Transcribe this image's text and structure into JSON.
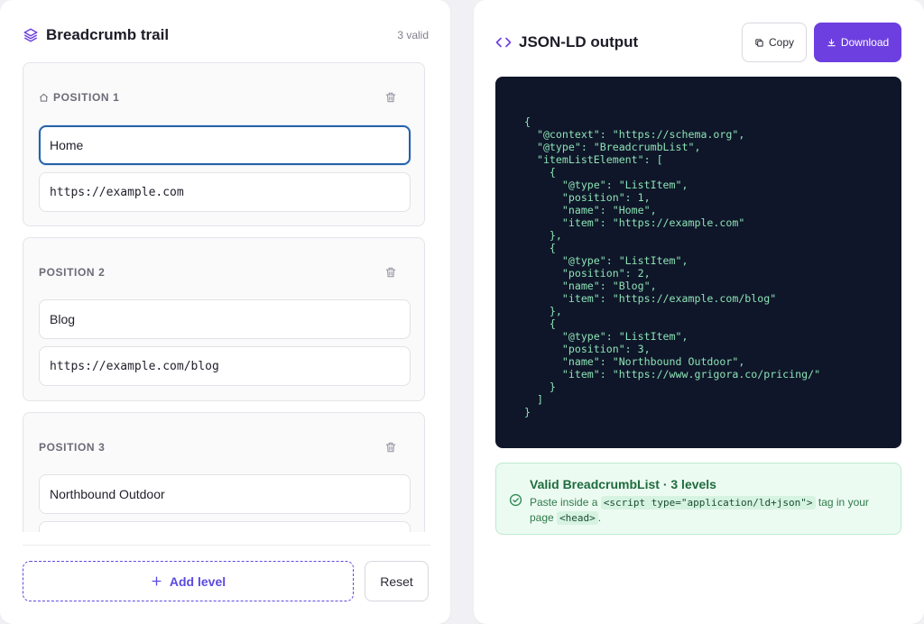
{
  "left": {
    "title": "Breadcrumb trail",
    "valid_count": "3 valid",
    "items": [
      {
        "label": "POSITION 1",
        "name": "Home",
        "url": "https://example.com"
      },
      {
        "label": "POSITION 2",
        "name": "Blog",
        "url": "https://example.com/blog"
      },
      {
        "label": "POSITION 3",
        "name": "Northbound Outdoor",
        "url": "https://www.grigora.co/pricing/"
      }
    ],
    "add_label": "Add level",
    "reset_label": "Reset"
  },
  "right": {
    "title": "JSON-LD output",
    "copy_label": "Copy",
    "download_label": "Download",
    "code": "{\n  \"@context\": \"https://schema.org\",\n  \"@type\": \"BreadcrumbList\",\n  \"itemListElement\": [\n    {\n      \"@type\": \"ListItem\",\n      \"position\": 1,\n      \"name\": \"Home\",\n      \"item\": \"https://example.com\"\n    },\n    {\n      \"@type\": \"ListItem\",\n      \"position\": 2,\n      \"name\": \"Blog\",\n      \"item\": \"https://example.com/blog\"\n    },\n    {\n      \"@type\": \"ListItem\",\n      \"position\": 3,\n      \"name\": \"Northbound Outdoor\",\n      \"item\": \"https://www.grigora.co/pricing/\"\n    }\n  ]\n}",
    "status": {
      "title": "Valid BreadcrumbList · 3 levels",
      "text_before": "Paste inside a",
      "code_script": "<script type=\"application/ld+json\">",
      "text_middle": "tag in your page",
      "code_head": "<head>",
      "text_after": "."
    }
  },
  "colors": {
    "accent": "#6d3fe0",
    "focus": "#2563a8",
    "code_bg": "#0f1629",
    "code_text": "#8ce2b5",
    "success_bg": "#ecfbf1",
    "success_text": "#1f6b3f"
  },
  "icons": {
    "title_left": "layers-icon",
    "title_right": "code-brackets-icon",
    "position_1": "home-icon",
    "delete": "trash-icon",
    "add": "plus-icon",
    "copy": "copy-icon",
    "download": "download-icon",
    "status": "check-circle-icon"
  }
}
